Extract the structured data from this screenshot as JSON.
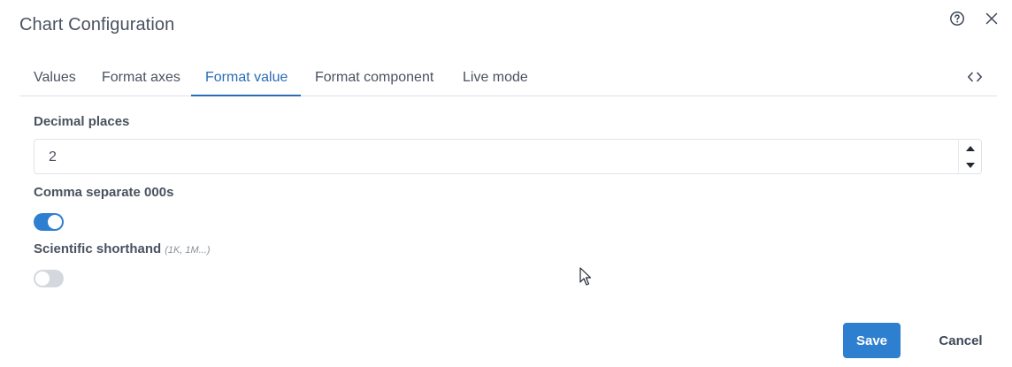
{
  "dialog": {
    "title": "Chart Configuration"
  },
  "icons": {
    "help": "help-circle-icon",
    "close": "close-icon",
    "code": "code-icon",
    "step_up": "caret-up-icon",
    "step_down": "caret-down-icon"
  },
  "tabs": [
    {
      "label": "Values",
      "active": false
    },
    {
      "label": "Format axes",
      "active": false
    },
    {
      "label": "Format value",
      "active": true
    },
    {
      "label": "Format component",
      "active": false
    },
    {
      "label": "Live mode",
      "active": false
    }
  ],
  "form": {
    "decimal_places": {
      "label": "Decimal places",
      "value": "2"
    },
    "comma_separate": {
      "label": "Comma separate 000s",
      "enabled": true
    },
    "scientific_shorthand": {
      "label": "Scientific shorthand",
      "hint": "(1K, 1M...)",
      "enabled": false
    }
  },
  "actions": {
    "save_label": "Save",
    "cancel_label": "Cancel"
  },
  "colors": {
    "accent": "#2f7fd0",
    "active_tab": "#2a6db5",
    "toggle_off": "#d3d8df"
  }
}
